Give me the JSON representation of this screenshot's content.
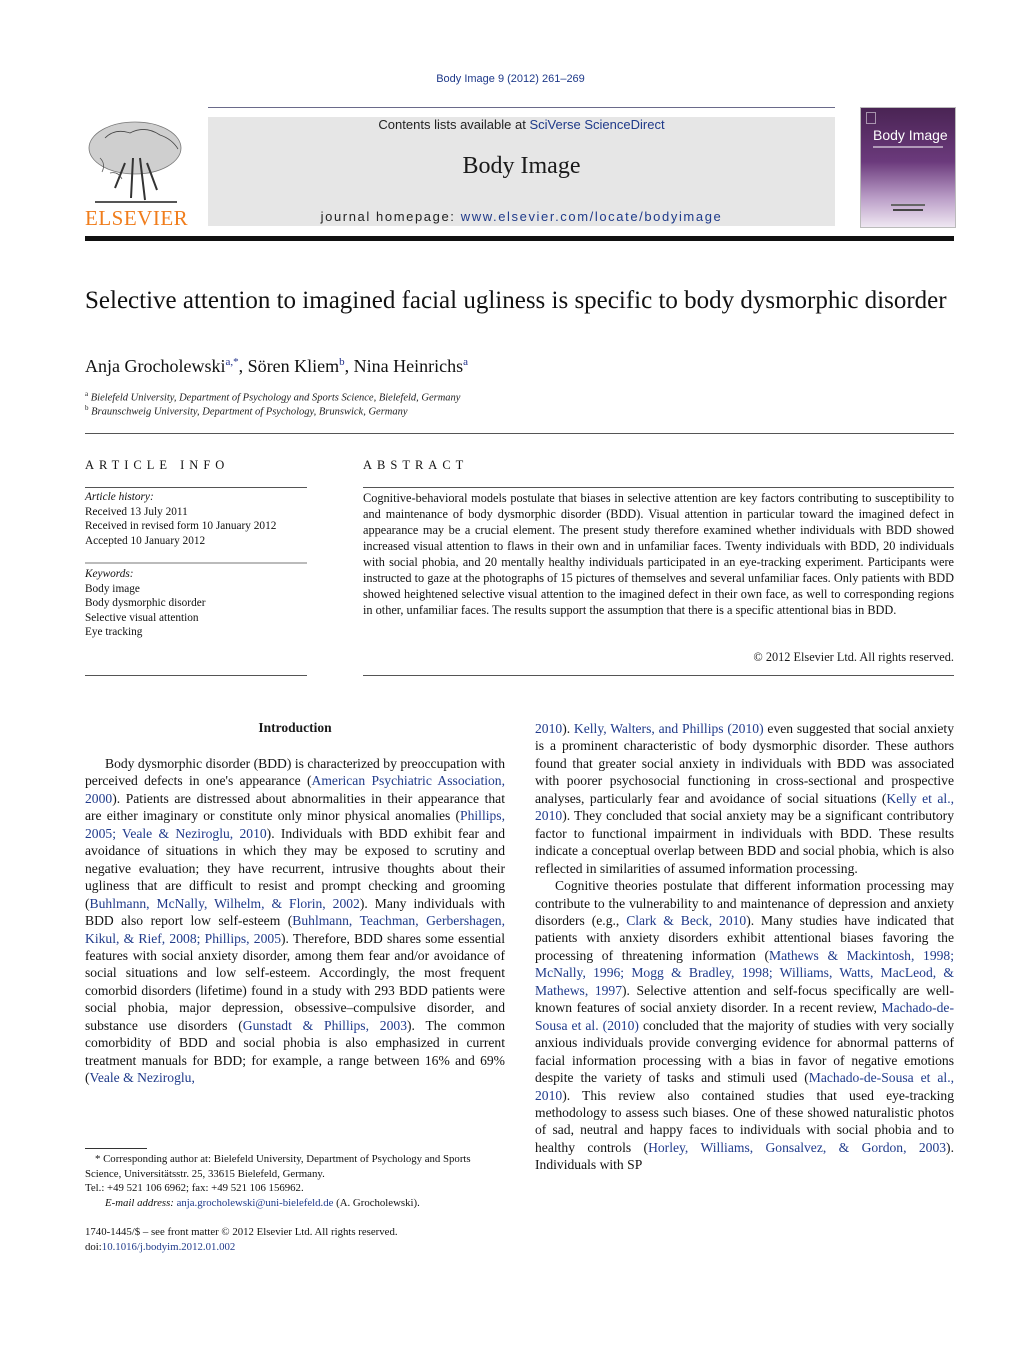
{
  "header": {
    "citation": "Body Image 9 (2012) 261–269",
    "contents_prefix": "Contents lists available at ",
    "contents_link": "SciVerse ScienceDirect",
    "journal_name": "Body Image",
    "homepage_prefix": "journal homepage: ",
    "homepage_link": "www.elsevier.com/locate/bodyimage",
    "publisher_logo_text": "ELSEVIER",
    "cover_title": "Body Image",
    "colors": {
      "link": "#1f3a8a",
      "publisher": "#f07d1c",
      "cover": "#5a2c66",
      "banner": "#e6e6e6"
    }
  },
  "article": {
    "title": "Selective attention to imagined facial ugliness is specific to body dysmorphic disorder",
    "authors": [
      {
        "name": "Anja Grocholewski",
        "sup": "a,*",
        "sep": ", "
      },
      {
        "name": "Sören Kliem",
        "sup": "b",
        "sep": ", "
      },
      {
        "name": "Nina Heinrichs",
        "sup": "a",
        "sep": ""
      }
    ],
    "affiliations": [
      {
        "mark": "a",
        "text": "Bielefeld University, Department of Psychology and Sports Science, Bielefeld, Germany"
      },
      {
        "mark": "b",
        "text": "Braunschweig University, Department of Psychology, Brunswick, Germany"
      }
    ]
  },
  "article_info": {
    "heading": "ARTICLE INFO",
    "history_label": "Article history:",
    "history": [
      "Received 13 July 2011",
      "Received in revised form 10 January 2012",
      "Accepted 10 January 2012"
    ],
    "keywords_label": "Keywords:",
    "keywords": [
      "Body image",
      "Body dysmorphic disorder",
      "Selective visual attention",
      "Eye tracking"
    ]
  },
  "abstract": {
    "heading": "ABSTRACT",
    "text": "Cognitive-behavioral models postulate that biases in selective attention are key factors contributing to susceptibility to and maintenance of body dysmorphic disorder (BDD). Visual attention in particular toward the imagined defect in appearance may be a crucial element. The present study therefore examined whether individuals with BDD showed increased visual attention to flaws in their own and in unfamiliar faces. Twenty individuals with BDD, 20 individuals with social phobia, and 20 mentally healthy individuals participated in an eye-tracking experiment. Participants were instructed to gaze at the photographs of 15 pictures of themselves and several unfamiliar faces. Only patients with BDD showed heightened selective visual attention to the imagined defect in their own face, as well to corresponding regions in other, unfamiliar faces. The results support the assumption that there is a specific attentional bias in BDD.",
    "copyright": "© 2012 Elsevier Ltd. All rights reserved."
  },
  "introduction": {
    "heading": "Introduction",
    "left_col": [
      {
        "t": "Body dysmorphic disorder (BDD) is characterized by preoccupation with perceived defects in one's appearance ("
      },
      {
        "l": "American Psychiatric Association, 2000"
      },
      {
        "t": "). Patients are distressed about abnormalities in their appearance that are either imaginary or constitute only minor physical anomalies ("
      },
      {
        "l": "Phillips, 2005; Veale & Neziroglu, 2010"
      },
      {
        "t": "). Individuals with BDD exhibit fear and avoidance of situations in which they may be exposed to scrutiny and negative evaluation; they have recurrent, intrusive thoughts about their ugliness that are difficult to resist and prompt checking and grooming ("
      },
      {
        "l": "Buhlmann, McNally, Wilhelm, & Florin, 2002"
      },
      {
        "t": "). Many individuals with BDD also report low self-esteem ("
      },
      {
        "l": "Buhlmann, Teachman, Gerbershagen, Kikul, & Rief, 2008; Phillips, 2005"
      },
      {
        "t": "). Therefore, BDD shares some essential features with social anxiety disorder, among them fear and/or avoidance of social situations and low self-esteem. Accordingly, the most frequent comorbid disorders (lifetime) found in a study with 293 BDD patients were social phobia, major depression, obsessive–compulsive disorder, and substance use disorders ("
      },
      {
        "l": "Gunstadt & Phillips, 2003"
      },
      {
        "t": "). The common comorbidity of BDD and social phobia is also emphasized in current treatment manuals for BDD; for example, a range between 16% and 69% ("
      },
      {
        "l": "Veale & Neziroglu,"
      }
    ],
    "right_p1": [
      {
        "l": "2010"
      },
      {
        "t": "). "
      },
      {
        "l": "Kelly, Walters, and Phillips (2010)"
      },
      {
        "t": " even suggested that social anxiety is a prominent characteristic of body dysmorphic disorder. These authors found that greater social anxiety in individuals with BDD was associated with poorer psychosocial functioning in cross-sectional and prospective analyses, particularly fear and avoidance of social situations ("
      },
      {
        "l": "Kelly et al., 2010"
      },
      {
        "t": "). They concluded that social anxiety may be a significant contributory factor to functional impairment in individuals with BDD. These results indicate a conceptual overlap between BDD and social phobia, which is also reflected in similarities of assumed information processing."
      }
    ],
    "right_p2": [
      {
        "t": "Cognitive theories postulate that different information processing may contribute to the vulnerability to and maintenance of depression and anxiety disorders (e.g., "
      },
      {
        "l": "Clark & Beck, 2010"
      },
      {
        "t": "). Many studies have indicated that patients with anxiety disorders exhibit attentional biases favoring the processing of threatening information ("
      },
      {
        "l": "Mathews & Mackintosh, 1998; McNally, 1996; Mogg & Bradley, 1998; Williams, Watts, MacLeod, & Mathews, 1997"
      },
      {
        "t": "). Selective attention and self-focus specifically are well-known features of social anxiety disorder. In a recent review, "
      },
      {
        "l": "Machado-de-Sousa et al. (2010)"
      },
      {
        "t": " concluded that the majority of studies with very socially anxious individuals provide converging evidence for abnormal patterns of facial information processing with a bias in favor of negative emotions despite the variety of tasks and stimuli used ("
      },
      {
        "l": "Machado-de-Sousa et al., 2010"
      },
      {
        "t": "). This review also contained studies that used eye-tracking methodology to assess such biases. One of these showed naturalistic photos of sad, neutral and happy faces to individuals with social phobia and to healthy controls ("
      },
      {
        "l": "Horley, Williams, Gonsalvez, & Gordon, 2003"
      },
      {
        "t": "). Individuals with SP"
      }
    ]
  },
  "footnotes": {
    "corresponding": "* Corresponding author at: Bielefeld University, Department of Psychology and Sports Science, Universitätsstr. 25, 33615 Bielefeld, Germany.",
    "tel": "Tel.: +49 521 106 6962; fax: +49 521 106 156962.",
    "email_label": "E-mail address: ",
    "email": "anja.grocholewski@uni-bielefeld.de",
    "email_suffix": " (A. Grocholewski).",
    "issn": "1740-1445/$ – see front matter © 2012 Elsevier Ltd. All rights reserved.",
    "doi_prefix": "doi:",
    "doi": "10.1016/j.bodyim.2012.01.002"
  }
}
